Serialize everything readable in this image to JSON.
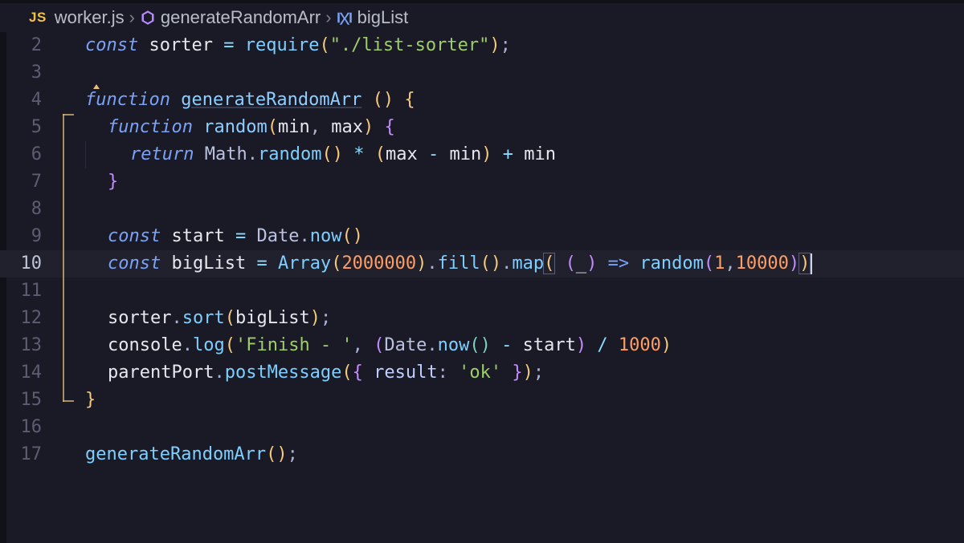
{
  "breadcrumb": {
    "js_badge": "JS",
    "file": "worker.js",
    "symbol1": "generateRandomArr",
    "symbol2": "bigList"
  },
  "editor": {
    "line_numbers": [
      "2",
      "3",
      "4",
      "5",
      "6",
      "7",
      "8",
      "9",
      "10",
      "11",
      "12",
      "13",
      "14",
      "15",
      "16",
      "17"
    ],
    "tokens": {
      "l2": {
        "kw": "const",
        "sp": " ",
        "v": "sorter",
        "eq": " = ",
        "fn": "require",
        "lp": "(",
        "str": "\"./list-sorter\"",
        "rp": ")",
        "end": ";"
      },
      "l4": {
        "kw": "function",
        "sp": " ",
        "name": "generateRandomArr",
        "sp2": " ",
        "lp": "()",
        "sp3": " ",
        "lb": "{"
      },
      "l5": {
        "kw": "function",
        "sp": " ",
        "name": "random",
        "lp": "(",
        "a1": "min",
        "c": ", ",
        "a2": "max",
        "rp": ")",
        "sp2": " ",
        "lb": "{"
      },
      "l6": {
        "kw": "return",
        "sp": " ",
        "obj": "Math",
        "dot": ".",
        "fn": "random",
        "lp": "()",
        "sp2": " ",
        "op1": "*",
        "sp3": " ",
        "lp2": "(",
        "v1": "max",
        "sp4": " ",
        "op2": "-",
        "sp5": " ",
        "v2": "min",
        "rp2": ")",
        "sp6": " ",
        "op3": "+",
        "sp7": " ",
        "v3": "min"
      },
      "l7": {
        "rb": "}"
      },
      "l9": {
        "kw": "const",
        "sp": " ",
        "v": "start",
        "eq": " = ",
        "obj": "Date",
        "dot": ".",
        "fn": "now",
        "lp": "()"
      },
      "l10": {
        "kw": "const",
        "sp": " ",
        "v": "bigList",
        "eq": " = ",
        "obj": "Array",
        "lp": "(",
        "n1": "2000000",
        "rp": ")",
        "dot": ".",
        "fn1": "fill",
        "lp2": "()",
        "dot2": ".",
        "fn2": "map",
        "lp3": "(",
        "sp2": " ",
        "lp4": "(",
        "u": "_",
        "rp4": ")",
        "sp3": " ",
        "arrow": "=>",
        "sp4": " ",
        "fn3": "random",
        "lp5": "(",
        "n2": "1",
        "c": ",",
        "n3": "10000",
        "rp5": ")",
        "rp3": ")"
      },
      "l12": {
        "v": "sorter",
        "dot": ".",
        "fn": "sort",
        "lp": "(",
        "arg": "bigList",
        "rp": ")",
        "end": ";"
      },
      "l13": {
        "v": "console",
        "dot": ".",
        "fn": "log",
        "lp": "(",
        "str": "'Finish - '",
        "c": ", ",
        "lp2": "(",
        "obj": "Date",
        "dot2": ".",
        "fn2": "now",
        "lp3": "()",
        "sp": " ",
        "op": "-",
        "sp2": " ",
        "v2": "start",
        "rp2": ")",
        "sp3": " ",
        "op2": "/",
        "sp4": " ",
        "n": "1000",
        "rp": ")"
      },
      "l14": {
        "v": "parentPort",
        "dot": ".",
        "fn": "postMessage",
        "lp": "(",
        "lb": "{ ",
        "k": "result",
        "col": ": ",
        "str": "'ok'",
        "rb": " }",
        "rp": ")",
        "end": ";"
      },
      "l15": {
        "rb": "}"
      },
      "l17": {
        "fn": "generateRandomArr",
        "lp": "()",
        "end": ";"
      }
    }
  }
}
